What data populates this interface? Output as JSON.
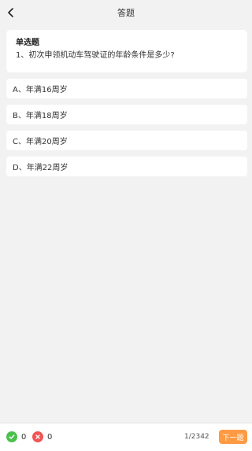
{
  "header": {
    "title": "答题",
    "back_icon": "chevron-left-icon"
  },
  "question": {
    "type_label": "单选题",
    "text": "1、初次申领机动车驾驶证的年龄条件是多少?"
  },
  "options": [
    {
      "label": "A、年满16周岁"
    },
    {
      "label": "B、年满18周岁"
    },
    {
      "label": "C、年满20周岁"
    },
    {
      "label": "D、年满22周岁"
    }
  ],
  "footer": {
    "correct_count": "0",
    "wrong_count": "0",
    "progress": "1/2342",
    "next_label": "下一题",
    "correct_color": "#4cc04c",
    "wrong_color": "#f05454",
    "accent_color": "#ff9a44"
  }
}
